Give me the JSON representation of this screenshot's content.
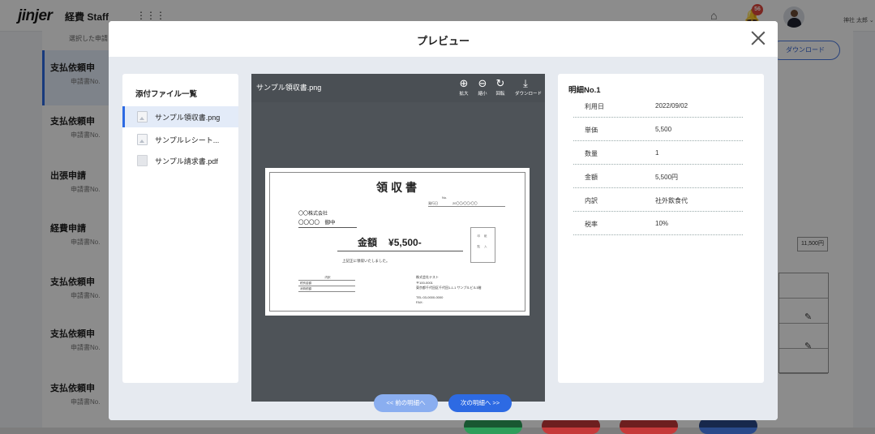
{
  "app": {
    "logo": "jinjer",
    "name": "経費 Staff",
    "user_name": "神社 太郎",
    "notification_count": "56"
  },
  "background": {
    "top_button": "選択した申請",
    "download_button": "ダウンロード",
    "amount_cell": "11,500円",
    "list": [
      {
        "title": "支払依頼申",
        "sub": "申請書No."
      },
      {
        "title": "支払依頼申",
        "sub": "申請書No."
      },
      {
        "title": "出張申請",
        "sub": "申請書No."
      },
      {
        "title": "経費申請",
        "sub": "申請書No."
      },
      {
        "title": "支払依頼申",
        "sub": "申請書No."
      },
      {
        "title": "支払依頼申",
        "sub": "申請書No."
      },
      {
        "title": "支払依頼申",
        "sub": "申請書No."
      }
    ],
    "colors": {
      "green": "#2e9e5b",
      "red": "#c63a3a",
      "red2": "#c63a3a",
      "navy": "#2a4a8a"
    }
  },
  "modal": {
    "title": "プレビュー",
    "files": {
      "heading": "添付ファイル一覧",
      "items": [
        {
          "name": "サンプル領収書.png",
          "icon": "image-file-icon"
        },
        {
          "name": "サンプルレシート...",
          "icon": "image-file-icon"
        },
        {
          "name": "サンプル請求書.pdf",
          "icon": "pdf-file-icon"
        }
      ]
    },
    "viewer": {
      "filename": "サンプル領収書.png",
      "tools": [
        {
          "icon": "zoom-in-icon",
          "label": "拡大",
          "glyph": "⊕"
        },
        {
          "icon": "zoom-out-icon",
          "label": "縮小",
          "glyph": "⊖"
        },
        {
          "icon": "rotate-icon",
          "label": "回転",
          "glyph": "↻"
        },
        {
          "icon": "download-icon",
          "label": "ダウンロード",
          "glyph": "⤓"
        }
      ]
    },
    "receipt": {
      "title": "領収書",
      "no_label": "No.",
      "date_label": "発行日",
      "date_value": "20〇〇/〇〇/〇〇",
      "company": "〇〇株式会社",
      "to": "〇〇〇〇　御中",
      "amount_label": "金額",
      "amount_value": "¥5,500-",
      "stamp_line1": "印 紙",
      "stamp_line2": "貼 入",
      "received": "上記正に領収いたしました。",
      "table_head": "内訳",
      "table_row1": "税別金額",
      "table_row2": "消費税額",
      "issuer_name": "株式会社テスト",
      "issuer_zip": "〒100-0001",
      "issuer_addr": "東京都千代田区千代田1-1-1 サンプルビル3階",
      "issuer_tel": "TEL:03-0000-0000",
      "issuer_fax": "FAX:"
    },
    "detail": {
      "title": "明細No.1",
      "rows": [
        {
          "key": "利用日",
          "value": "2022/09/02"
        },
        {
          "key": "単価",
          "value": "5,500"
        },
        {
          "key": "数量",
          "value": "1"
        },
        {
          "key": "金額",
          "value": "5,500円"
        },
        {
          "key": "内訳",
          "value": "社外飲食代"
        },
        {
          "key": "税率",
          "value": "10%"
        }
      ]
    },
    "nav": {
      "prev": "<< 前の明細へ",
      "next": "次の明細へ >>"
    }
  }
}
